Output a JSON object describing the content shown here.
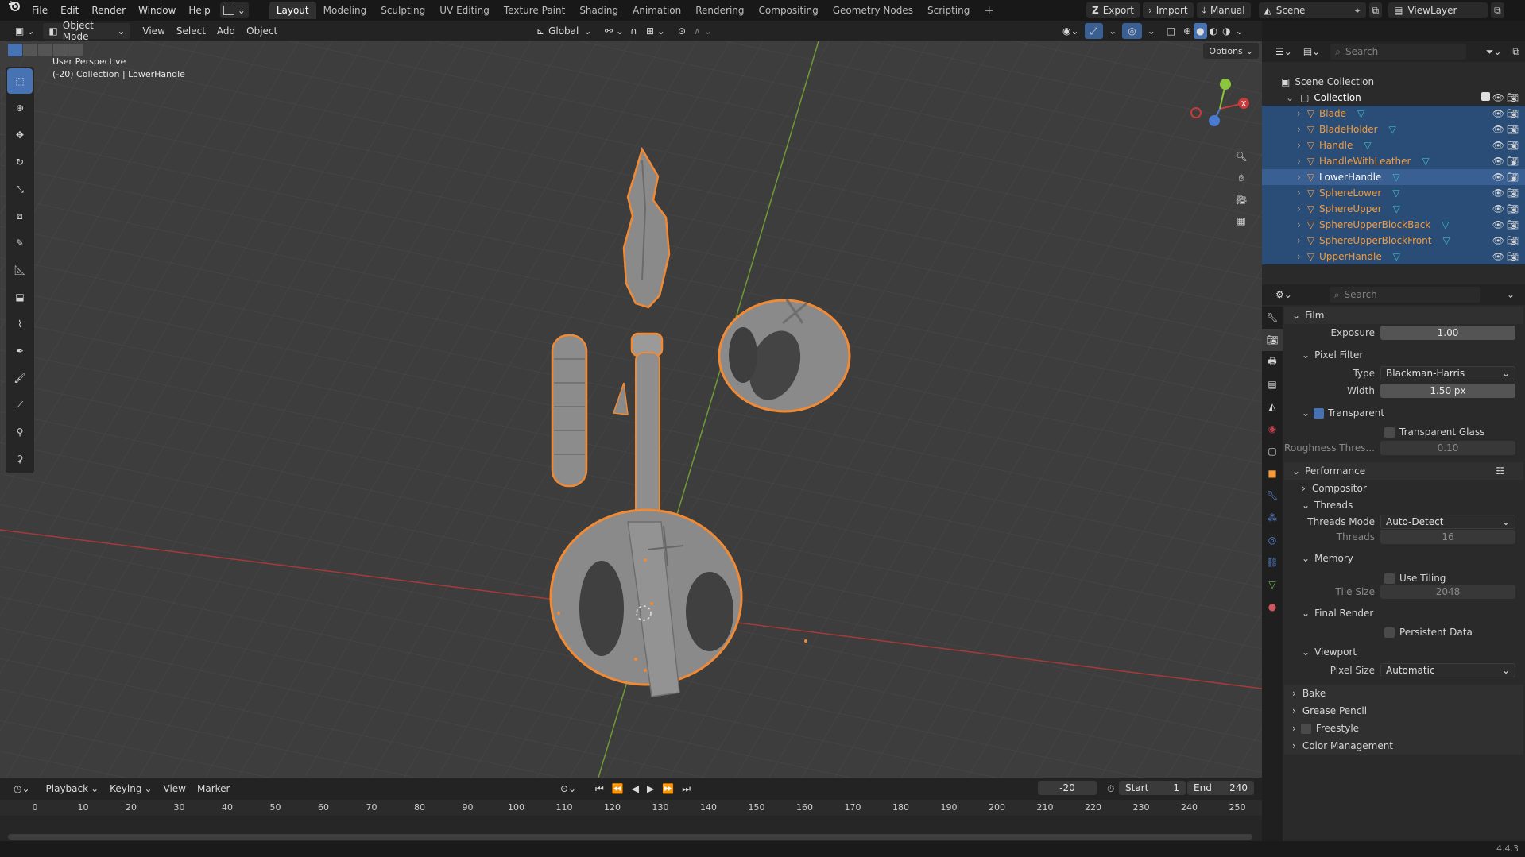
{
  "menu": {
    "app_icon": "blender-icon",
    "items": [
      "File",
      "Edit",
      "Render",
      "Window",
      "Help"
    ]
  },
  "workspaces": {
    "tabs": [
      "Layout",
      "Modeling",
      "Sculpting",
      "UV Editing",
      "Texture Paint",
      "Shading",
      "Animation",
      "Rendering",
      "Compositing",
      "Geometry Nodes",
      "Scripting"
    ],
    "active": "Layout",
    "add": "+"
  },
  "top_right": {
    "export": "Export",
    "import": "Import",
    "manual": "Manual",
    "scene": "Scene",
    "view_layer": "ViewLayer"
  },
  "viewport_header": {
    "mode": "Object Mode",
    "menus": [
      "View",
      "Select",
      "Add",
      "Object"
    ],
    "orientation": "Global",
    "options": "Options"
  },
  "viewport": {
    "perspective": "User Perspective",
    "context": "(-20) Collection | LowerHandle",
    "gizmo": {
      "x": "X",
      "y": "Y",
      "z": "Z"
    }
  },
  "outliner": {
    "search_placeholder": "Search",
    "scene_collection": "Scene Collection",
    "collection": "Collection",
    "objects": [
      "Blade",
      "BladeHolder",
      "Handle",
      "HandleWithLeather",
      "LowerHandle",
      "SphereLower",
      "SphereUpper",
      "SphereUpperBlockBack",
      "SphereUpperBlockFront",
      "UpperHandle"
    ],
    "active": "LowerHandle"
  },
  "properties": {
    "search_placeholder": "Search",
    "film": {
      "title": "Film",
      "exposure_label": "Exposure",
      "exposure": "1.00",
      "pixel_filter": "Pixel Filter",
      "type_label": "Type",
      "type": "Blackman-Harris",
      "width_label": "Width",
      "width": "1.50 px",
      "transparent": "Transparent",
      "transparent_glass": "Transparent Glass",
      "roughness_label": "Roughness Thres...",
      "roughness": "0.10"
    },
    "performance": {
      "title": "Performance",
      "compositor": "Compositor",
      "threads": "Threads",
      "threads_mode_label": "Threads Mode",
      "threads_mode": "Auto-Detect",
      "threads_label": "Threads",
      "threads_value": "16",
      "memory": "Memory",
      "use_tiling": "Use Tiling",
      "tile_size_label": "Tile Size",
      "tile_size": "2048",
      "final_render": "Final Render",
      "persistent_data": "Persistent Data",
      "viewport": "Viewport",
      "pixel_size_label": "Pixel Size",
      "pixel_size": "Automatic"
    },
    "panels": [
      "Bake",
      "Grease Pencil",
      "Freestyle",
      "Color Management"
    ]
  },
  "timeline": {
    "menus": [
      "Playback",
      "Keying",
      "View",
      "Marker"
    ],
    "current_frame": "-20",
    "start_label": "Start",
    "start": "1",
    "end_label": "End",
    "end": "240",
    "ruler": [
      "0",
      "10",
      "20",
      "30",
      "40",
      "50",
      "60",
      "70",
      "80",
      "90",
      "100",
      "110",
      "120",
      "130",
      "140",
      "150",
      "160",
      "170",
      "180",
      "190",
      "200",
      "210",
      "220",
      "230",
      "240",
      "250"
    ]
  },
  "status": {
    "version": "4.4.3"
  },
  "colors": {
    "accent": "#4772b3",
    "selection_outline": "#f08a35",
    "x_axis": "#c83b3b",
    "y_axis": "#8cc63f",
    "object_orange": "#f29a3d"
  }
}
